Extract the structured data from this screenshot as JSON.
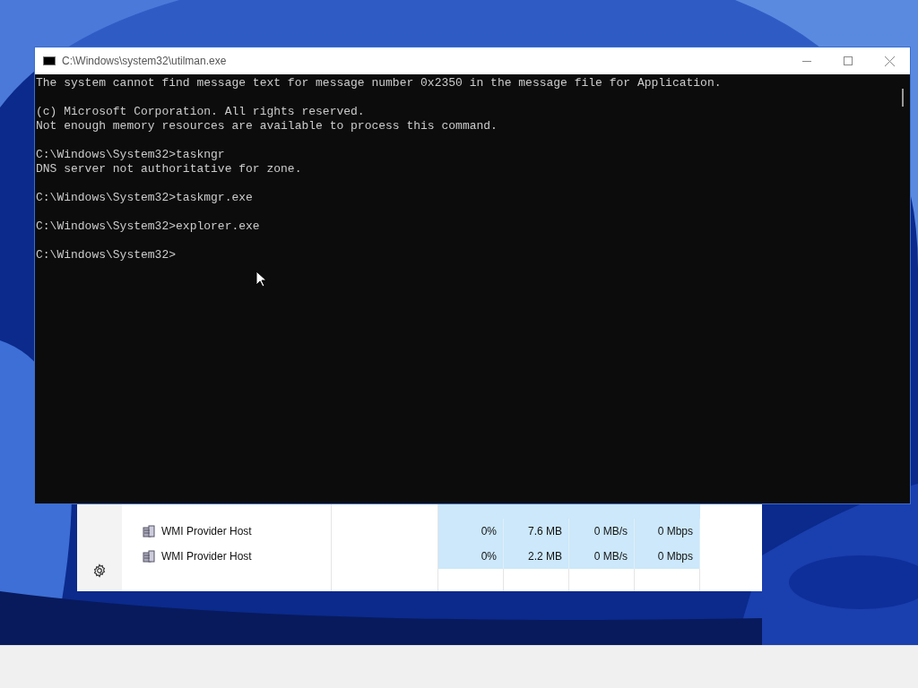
{
  "task_manager": {
    "rows": [
      {
        "name": "WMI Provider Host",
        "cpu": "0%",
        "memory": "7.6 MB",
        "disk": "0 MB/s",
        "network": "0 Mbps"
      },
      {
        "name": "WMI Provider Host",
        "cpu": "0%",
        "memory": "2.2 MB",
        "disk": "0 MB/s",
        "network": "0 Mbps"
      }
    ]
  },
  "console": {
    "title": "C:\\Windows\\system32\\utilman.exe",
    "blocks": [
      [
        "The system cannot find message text for message number 0x2350 in the message file for Application."
      ],
      [
        "(c) Microsoft Corporation. All rights reserved.",
        "Not enough memory resources are available to process this command."
      ],
      [
        "C:\\Windows\\System32>taskngr",
        "DNS server not authoritative for zone."
      ],
      [
        "C:\\Windows\\System32>taskmgr.exe"
      ],
      [
        "C:\\Windows\\System32>explorer.exe"
      ],
      [
        "C:\\Windows\\System32>"
      ]
    ]
  }
}
